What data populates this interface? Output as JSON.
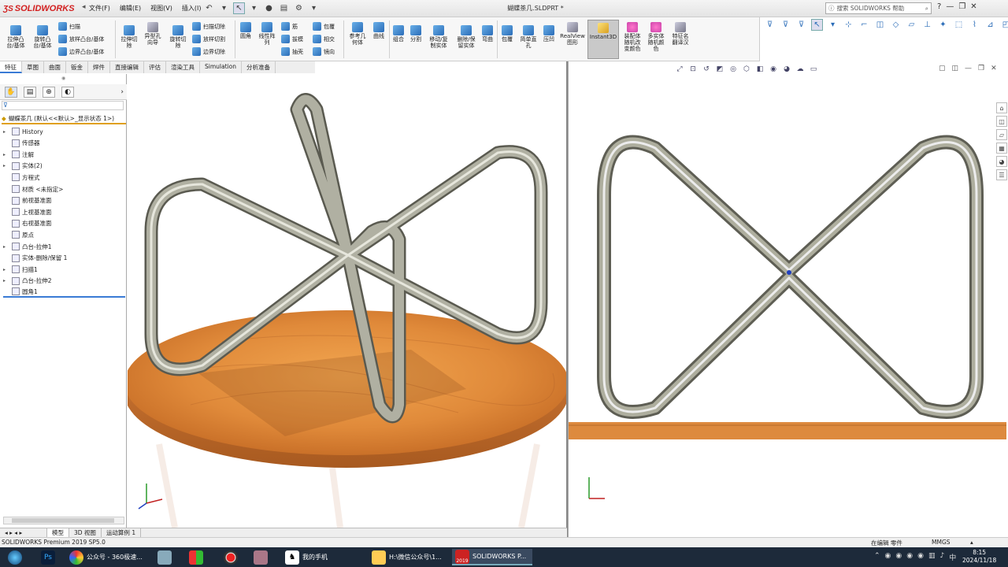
{
  "app": {
    "logo_text": "SOLIDWORKS",
    "doc_title": "蝴蝶茶几.SLDPRT *"
  },
  "menu": [
    "文件(F)",
    "编辑(E)",
    "视图(V)",
    "插入(I)"
  ],
  "search": {
    "placeholder": "搜索 SOLIDWORKS 帮助"
  },
  "ribbon": {
    "big": [
      {
        "label": "拉伸凸\n台/基体"
      },
      {
        "label": "旋转凸\n台/基体"
      },
      {
        "label": "拉伸切\n除"
      },
      {
        "label": "异型孔\n向导"
      },
      {
        "label": "旋转切\n除"
      },
      {
        "label": "圆角"
      },
      {
        "label": "线性阵\n列"
      },
      {
        "label": "参考几\n何体"
      },
      {
        "label": "曲线"
      },
      {
        "label": "组合"
      },
      {
        "label": "分割"
      },
      {
        "label": "移动/复\n制实体"
      },
      {
        "label": "删除/保\n留实体"
      },
      {
        "label": "弯曲"
      },
      {
        "label": "包覆"
      },
      {
        "label": "简单直\n孔"
      },
      {
        "label": "压凹"
      },
      {
        "label": "RealView\n图形"
      },
      {
        "label": "Instant3D"
      },
      {
        "label": "装配体\n随机改\n变颜色"
      },
      {
        "label": "多实体\n随机颜\n色"
      },
      {
        "label": "特征名\n翻译汉"
      }
    ],
    "small": [
      {
        "label": "扫描"
      },
      {
        "label": "放样凸台/基体"
      },
      {
        "label": "边界凸台/基体"
      },
      {
        "label": "扫描切除"
      },
      {
        "label": "放样切割"
      },
      {
        "label": "边界切除"
      },
      {
        "label": "筋"
      },
      {
        "label": "拔模"
      },
      {
        "label": "抽壳"
      },
      {
        "label": "包覆"
      },
      {
        "label": "相交"
      },
      {
        "label": "镜向"
      }
    ]
  },
  "tabs": [
    "特征",
    "草图",
    "曲面",
    "钣金",
    "焊件",
    "直接编辑",
    "评估",
    "渲染工具",
    "Simulation",
    "分析准备"
  ],
  "tree": {
    "root": "蝴蝶茶几  (默认<<默认>_显示状态 1>)",
    "items": [
      {
        "label": "History",
        "expand": "▸"
      },
      {
        "label": "传感器",
        "expand": ""
      },
      {
        "label": "注解",
        "expand": "▸"
      },
      {
        "label": "实体(2)",
        "expand": "▸"
      },
      {
        "label": "方程式",
        "expand": ""
      },
      {
        "label": "材质 <未指定>",
        "expand": ""
      },
      {
        "label": "前视基准面",
        "expand": ""
      },
      {
        "label": "上视基准面",
        "expand": ""
      },
      {
        "label": "右视基准面",
        "expand": ""
      },
      {
        "label": "原点",
        "expand": ""
      },
      {
        "label": "凸台-拉伸1",
        "expand": "▸"
      },
      {
        "label": "实体-删除/保留 1",
        "expand": ""
      },
      {
        "label": "扫描1",
        "expand": "▸"
      },
      {
        "label": "凸台-拉伸2",
        "expand": "▸"
      },
      {
        "label": "圆角1",
        "expand": ""
      }
    ]
  },
  "bottom_tabs": [
    "模型",
    "3D 视图",
    "运动算例 1"
  ],
  "status": {
    "left": "SOLIDWORKS Premium 2019 SP5.0",
    "edit": "在编辑 零件",
    "units": "MMGS"
  },
  "taskbar": {
    "items": [
      "公众号 - 360极速...",
      "我的手机",
      "H:\\微信公众号\\1...",
      "SOLIDWORKS P..."
    ],
    "badge": "2019",
    "time": "8:15",
    "date": "2024/11/18"
  },
  "colors": {
    "accent": "#3a7bd5",
    "wood": "#e08a3a",
    "metal": "#a8a898",
    "brand": "#d32020"
  }
}
